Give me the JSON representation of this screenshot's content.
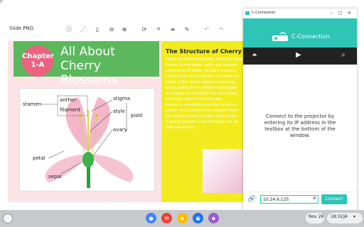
{
  "viewer": {
    "filename": "Slide.PNG",
    "toolbar_icons": [
      "info-icon",
      "share-icon",
      "delete-icon",
      "zoom-out-icon",
      "zoom-in-icon",
      "rotate-icon",
      "crop-icon",
      "edit-icon",
      "undo-icon",
      "redo-icon"
    ]
  },
  "slide": {
    "chapter_line1": "Chapter",
    "chapter_line2": "1-A",
    "title_line1": "All About",
    "title_line2": "Cherry Blossoms",
    "labels": {
      "stamen": "stamen",
      "anther": "anther",
      "filament": "filament",
      "stigma": "stigma",
      "style": "style",
      "pistil": "pistil",
      "ovary": "ovary",
      "petal": "petal",
      "sepal": "sepal"
    },
    "right_title": "The Structure of Cherry Bl",
    "right_lines": [
      "Petals are about the petals, there are sepals",
      "flowers in one flower, when we compare",
      "summarize all these, we call it a corolla.",
      "some similar to the wreath of another co",
      "inside of the corolla sepal is a word poi",
      "piece, calling it as a whole to put togeth",
      "A wrapper is a structure that will protect",
      "and buds, which is not the case.",
      "stamen is composed of anther to put po",
      "anther, and a pattern that supports filam",
      "The pistil consists of stigma with pollen,",
      "a part to become a seed called ovule, an",
      "that connects it."
    ]
  },
  "cconnection": {
    "window_title": "C-Connection",
    "brand": "C-Connection",
    "message": "Connect to the projector by entering its IP address in the textbox at the bottom of the window.",
    "ip_value": "10.24.6.125",
    "connect_label": "Connect",
    "accent": "#2ec4b6"
  },
  "shelf": {
    "date": "Nov 26",
    "time": "18:32",
    "locale": "JA"
  }
}
